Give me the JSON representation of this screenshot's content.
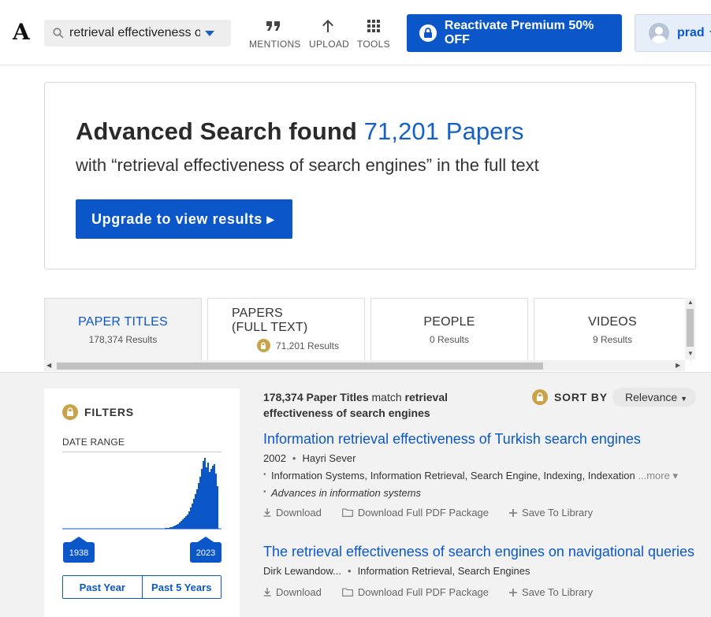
{
  "brand": {
    "logo": "A"
  },
  "search": {
    "value": "retrieval effectiveness of search engines"
  },
  "nav": {
    "mentions": "MENTIONS",
    "upload": "UPLOAD",
    "tools": "TOOLS"
  },
  "premium": {
    "label": "Reactivate Premium 50% OFF"
  },
  "user": {
    "name": "prad"
  },
  "hero": {
    "title_prefix": "Advanced Search found",
    "count": "71,201 Papers",
    "subtitle": "with “retrieval effectiveness of search engines” in the full text",
    "upgrade": "Upgrade to view results ▸"
  },
  "tabs": [
    {
      "title": "PAPER TITLES",
      "results": "178,374 Results"
    },
    {
      "title": "PAPERS",
      "title2": "(FULL TEXT)",
      "results": "71,201 Results"
    },
    {
      "title": "PEOPLE",
      "results": "0 Results"
    },
    {
      "title": "VIDEOS",
      "results": "9 Results"
    }
  ],
  "filters": {
    "heading": "FILTERS",
    "date_range": "DATE RANGE",
    "year_from": "1938",
    "year_to": "2023",
    "past_year": "Past Year",
    "past_5_years": "Past 5 Years"
  },
  "results": {
    "count": "178,374 Paper Titles",
    "match": "match",
    "query": "retrieval effectiveness of search engines",
    "sort_by": "SORT BY",
    "sort_value": "Relevance"
  },
  "papers": [
    {
      "title": "Information retrieval effectiveness of Turkish search engines",
      "year": "2002",
      "author": "Hayri Sever",
      "keywords": "Information Systems, Information Retrieval, Search Engine, Indexing, Indexation",
      "more": "...more ▾",
      "journal": "Advances in information systems",
      "download": "Download",
      "download_pdf": "Download Full PDF Package",
      "save": "Save To Library"
    },
    {
      "title": "The retrieval effectiveness of search engines on navigational queries",
      "author": "Dirk Lewandow...",
      "keywords": "Information Retrieval, Search Engines",
      "download": "Download",
      "download_pdf": "Download Full PDF Package",
      "save": "Save To Library"
    }
  ],
  "colors": {
    "accent": "#0b57c9",
    "lock": "#c9a34a"
  }
}
